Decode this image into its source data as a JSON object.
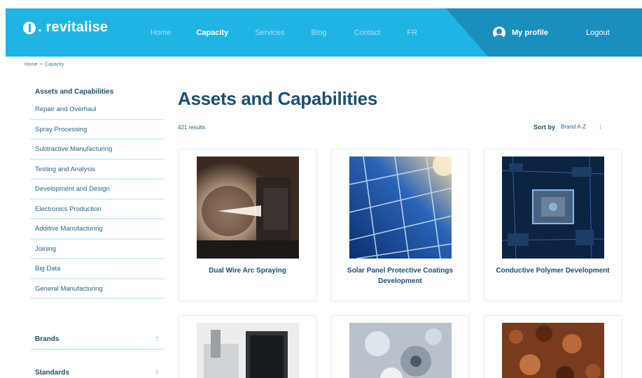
{
  "header": {
    "logo_text": ". revitalise",
    "nav": [
      {
        "label": "Home",
        "active": false
      },
      {
        "label": "Capacity",
        "active": true
      },
      {
        "label": "Services",
        "active": false
      },
      {
        "label": "Blog",
        "active": false
      },
      {
        "label": "Contact",
        "active": false
      },
      {
        "label": "FR",
        "active": false
      }
    ],
    "profile_label": "My profile",
    "logout_label": "Logout",
    "colors": {
      "bar": "#1fb4e4",
      "bar_dark": "#1a8fbd"
    }
  },
  "breadcrumb": {
    "home": "Home",
    "separator": "•",
    "current": "Capacity"
  },
  "sidebar": {
    "title": "Assets and Capabilities",
    "items": [
      "Repair and Overhaul",
      "Spray Processing",
      "Subtractive Manufacturing",
      "Testing and Analysis",
      "Development and Design",
      "Electronics Production",
      "Additive Manufacturing",
      "Joining",
      "Big Data",
      "General Manufacturing"
    ],
    "groups": [
      {
        "label": "Brands",
        "icon": "arrow-up-icon"
      },
      {
        "label": "Standards",
        "icon": "arrow-up-icon"
      }
    ]
  },
  "main": {
    "title": "Assets and Capabilities",
    "results": "421 results",
    "sort_label": "Sort by",
    "sort_value": "Brand A-Z"
  },
  "cards": [
    {
      "label": "Dual Wire Arc Spraying",
      "image": "spraying-photo"
    },
    {
      "label": "Solar Panel Protective Coatings Development",
      "image": "solar-panel-photo"
    },
    {
      "label": "Conductive Polymer Development",
      "image": "circuit-board-photo"
    },
    {
      "label": "",
      "image": "lab-equipment-photo"
    },
    {
      "label": "",
      "image": "metal-parts-photo"
    },
    {
      "label": "",
      "image": "soil-texture-photo"
    }
  ]
}
